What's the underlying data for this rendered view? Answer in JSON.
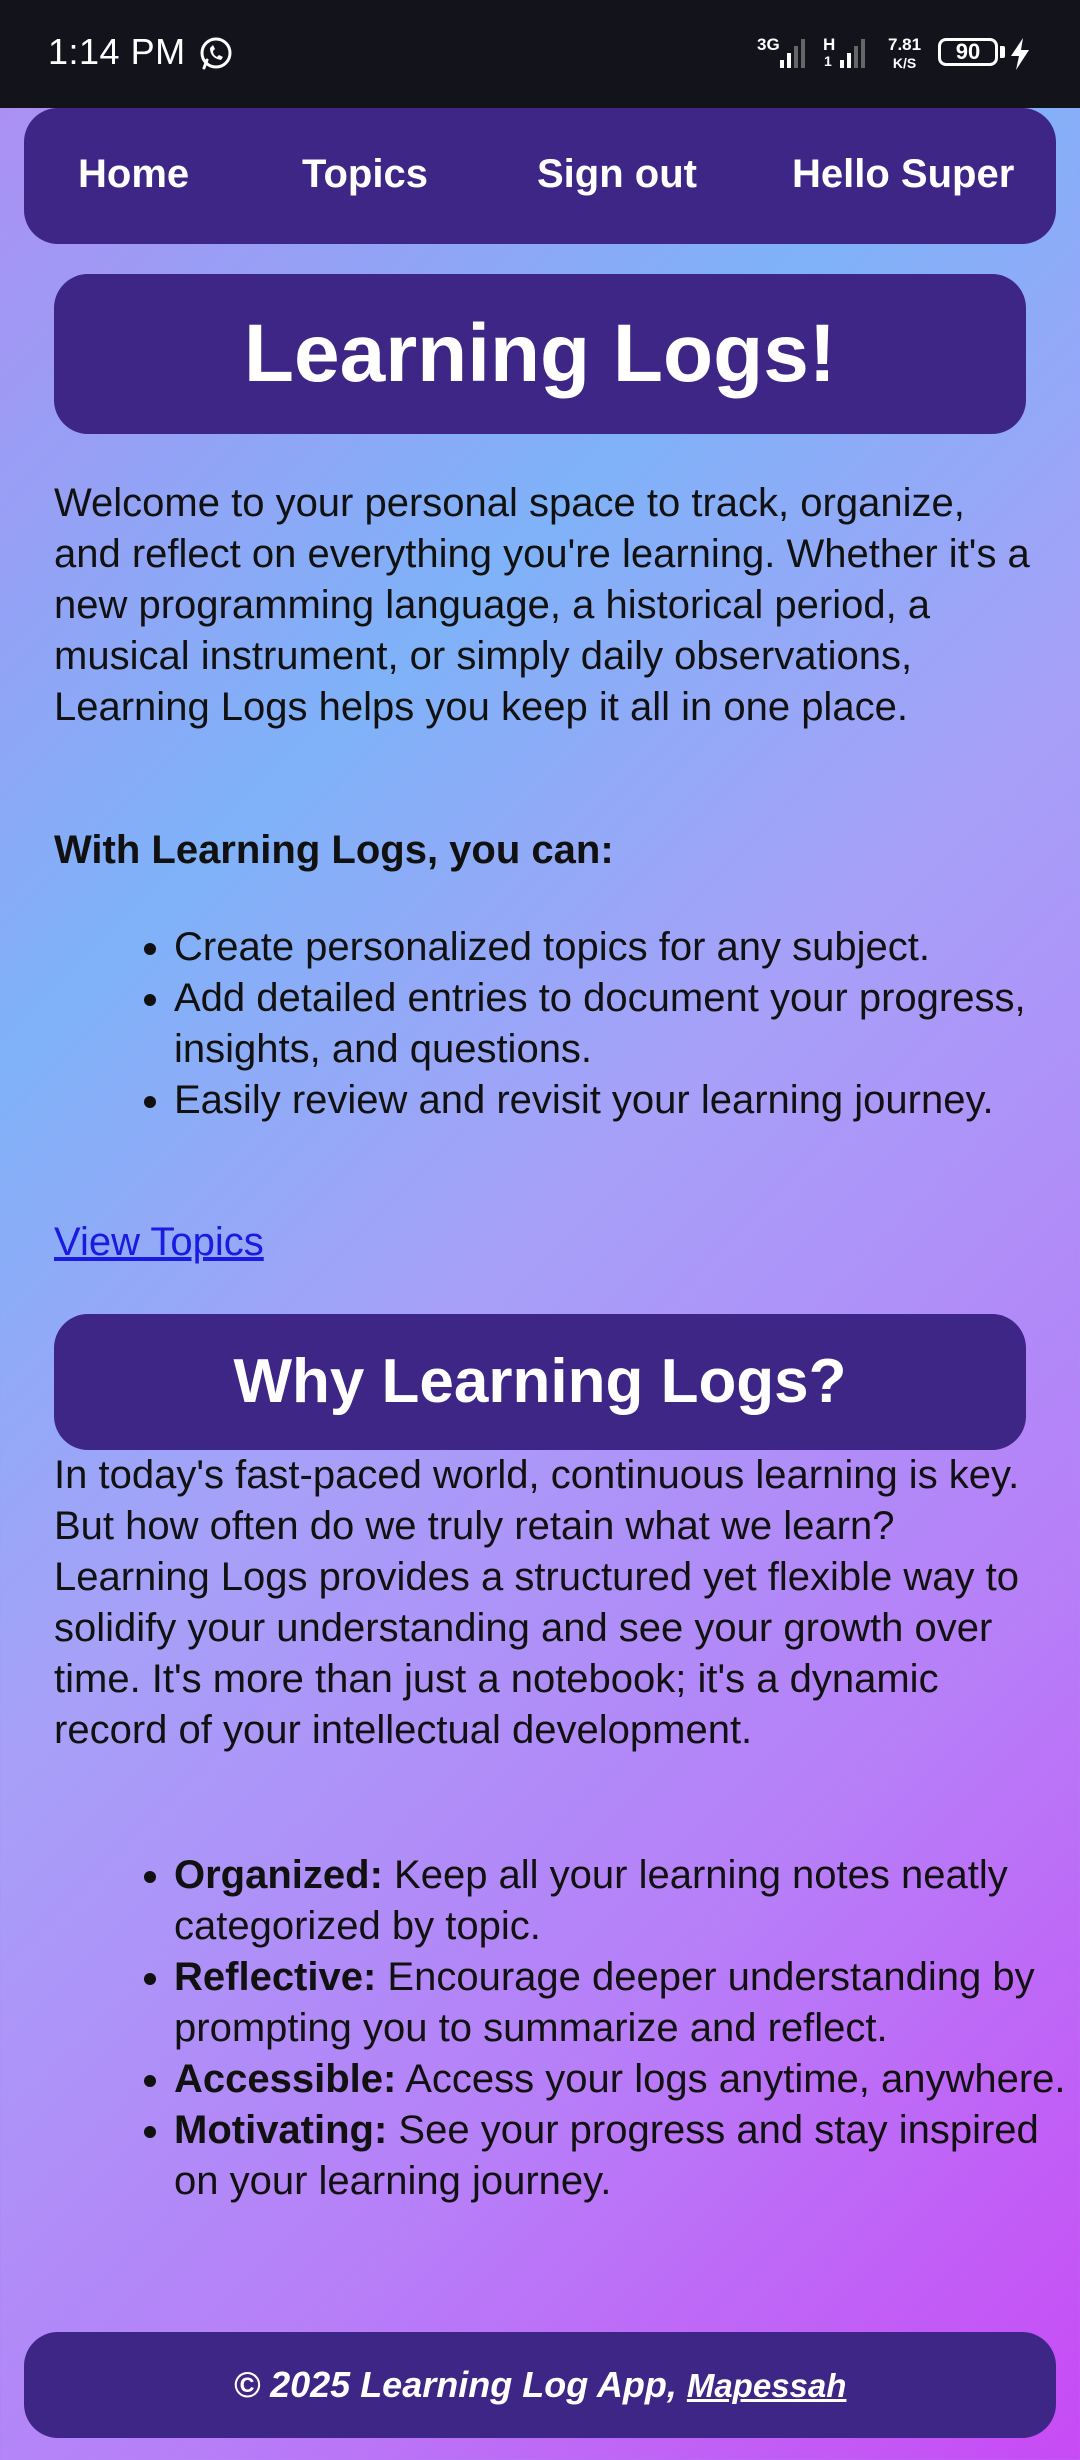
{
  "status_bar": {
    "time": "1:14 PM",
    "net1": "3G",
    "net2": "H",
    "net2_sub": "1",
    "speed_value": "7.81",
    "speed_unit": "K/S",
    "battery": "90",
    "icons": [
      "whatsapp-icon",
      "signal-icon",
      "signal-icon",
      "battery-icon",
      "charging-bolt-icon"
    ]
  },
  "nav": {
    "home": "Home",
    "topics": "Topics",
    "signout": "Sign out",
    "greeting": "Hello Super"
  },
  "hero": {
    "title": "Learning Logs!"
  },
  "intro": {
    "text": "Welcome to your personal space to track, organize, and reflect on everything you're learning. Whether it's a new programming language, a historical period, a musical instrument, or simply daily observations, Learning Logs helps you keep it all in one place.",
    "can_heading": "With Learning Logs, you can:",
    "can_items": [
      "Create personalized topics for any subject.",
      "Add detailed entries to document your progress, insights, and questions.",
      "Easily review and revisit your learning journey."
    ],
    "view_link": "View Topics"
  },
  "why": {
    "title": "Why Learning Logs?",
    "text": "In today's fast-paced world, continuous learning is key. But how often do we truly retain what we learn? Learning Logs provides a structured yet flexible way to solidify your understanding and see your growth over time. It's more than just a notebook; it's a dynamic record of your intellectual development.",
    "items": [
      {
        "label": "Organized:",
        "text": " Keep all your learning notes neatly categorized by topic."
      },
      {
        "label": "Reflective:",
        "text": " Encourage deeper understanding by prompting you to summarize and reflect."
      },
      {
        "label": "Accessible:",
        "text": " Access your logs anytime, anywhere."
      },
      {
        "label": "Motivating:",
        "text": " See your progress and stay inspired on your learning journey."
      }
    ]
  },
  "footer": {
    "text": "© 2025 Learning Log App, ",
    "link": "Mapessah"
  }
}
